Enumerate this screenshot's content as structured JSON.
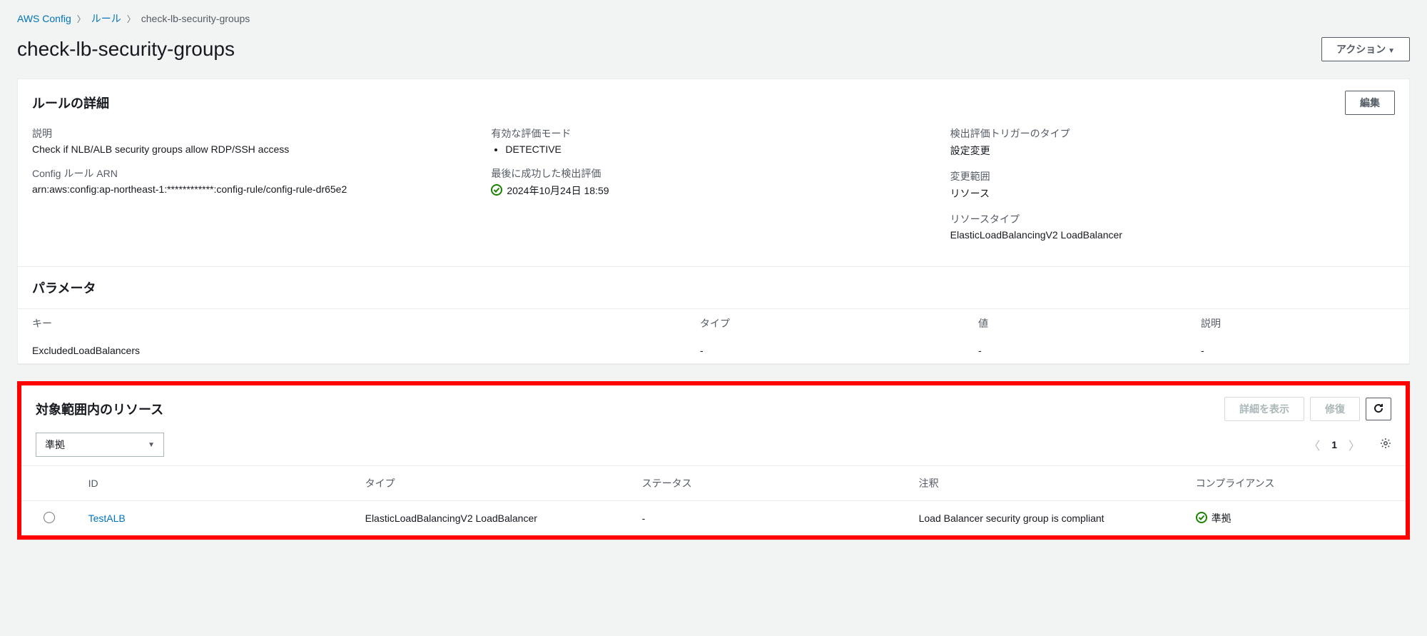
{
  "breadcrumb": {
    "root": "AWS Config",
    "rules": "ルール",
    "current": "check-lb-security-groups"
  },
  "page_title": "check-lb-security-groups",
  "actions_label": "アクション",
  "details": {
    "title": "ルールの詳細",
    "edit_label": "編集",
    "description_label": "説明",
    "description_value": "Check if NLB/ALB security groups allow RDP/SSH access",
    "arn_label": "Config ルール ARN",
    "arn_value": "arn:aws:config:ap-northeast-1:************:config-rule/config-rule-dr65e2",
    "eval_mode_label": "有効な評価モード",
    "eval_mode_value": "DETECTIVE",
    "last_success_label": "最後に成功した検出評価",
    "last_success_value": "2024年10月24日 18:59",
    "trigger_label": "検出評価トリガーのタイプ",
    "trigger_value": "設定変更",
    "scope_label": "変更範囲",
    "scope_value": "リソース",
    "resource_type_label": "リソースタイプ",
    "resource_type_value": "ElasticLoadBalancingV2 LoadBalancer"
  },
  "params": {
    "title": "パラメータ",
    "headers": {
      "key": "キー",
      "type": "タイプ",
      "value": "値",
      "desc": "説明"
    },
    "rows": [
      {
        "key": "ExcludedLoadBalancers",
        "type": "-",
        "value": "-",
        "desc": "-"
      }
    ]
  },
  "resources": {
    "title": "対象範囲内のリソース",
    "view_details_label": "詳細を表示",
    "remediate_label": "修復",
    "filter_selected": "準拠",
    "page_num": "1",
    "headers": {
      "id": "ID",
      "type": "タイプ",
      "status": "ステータス",
      "annotation": "注釈",
      "compliance": "コンプライアンス"
    },
    "rows": [
      {
        "id": "TestALB",
        "type": "ElasticLoadBalancingV2 LoadBalancer",
        "status": "-",
        "annotation": "Load Balancer security group is compliant",
        "compliance": "準拠"
      }
    ]
  }
}
